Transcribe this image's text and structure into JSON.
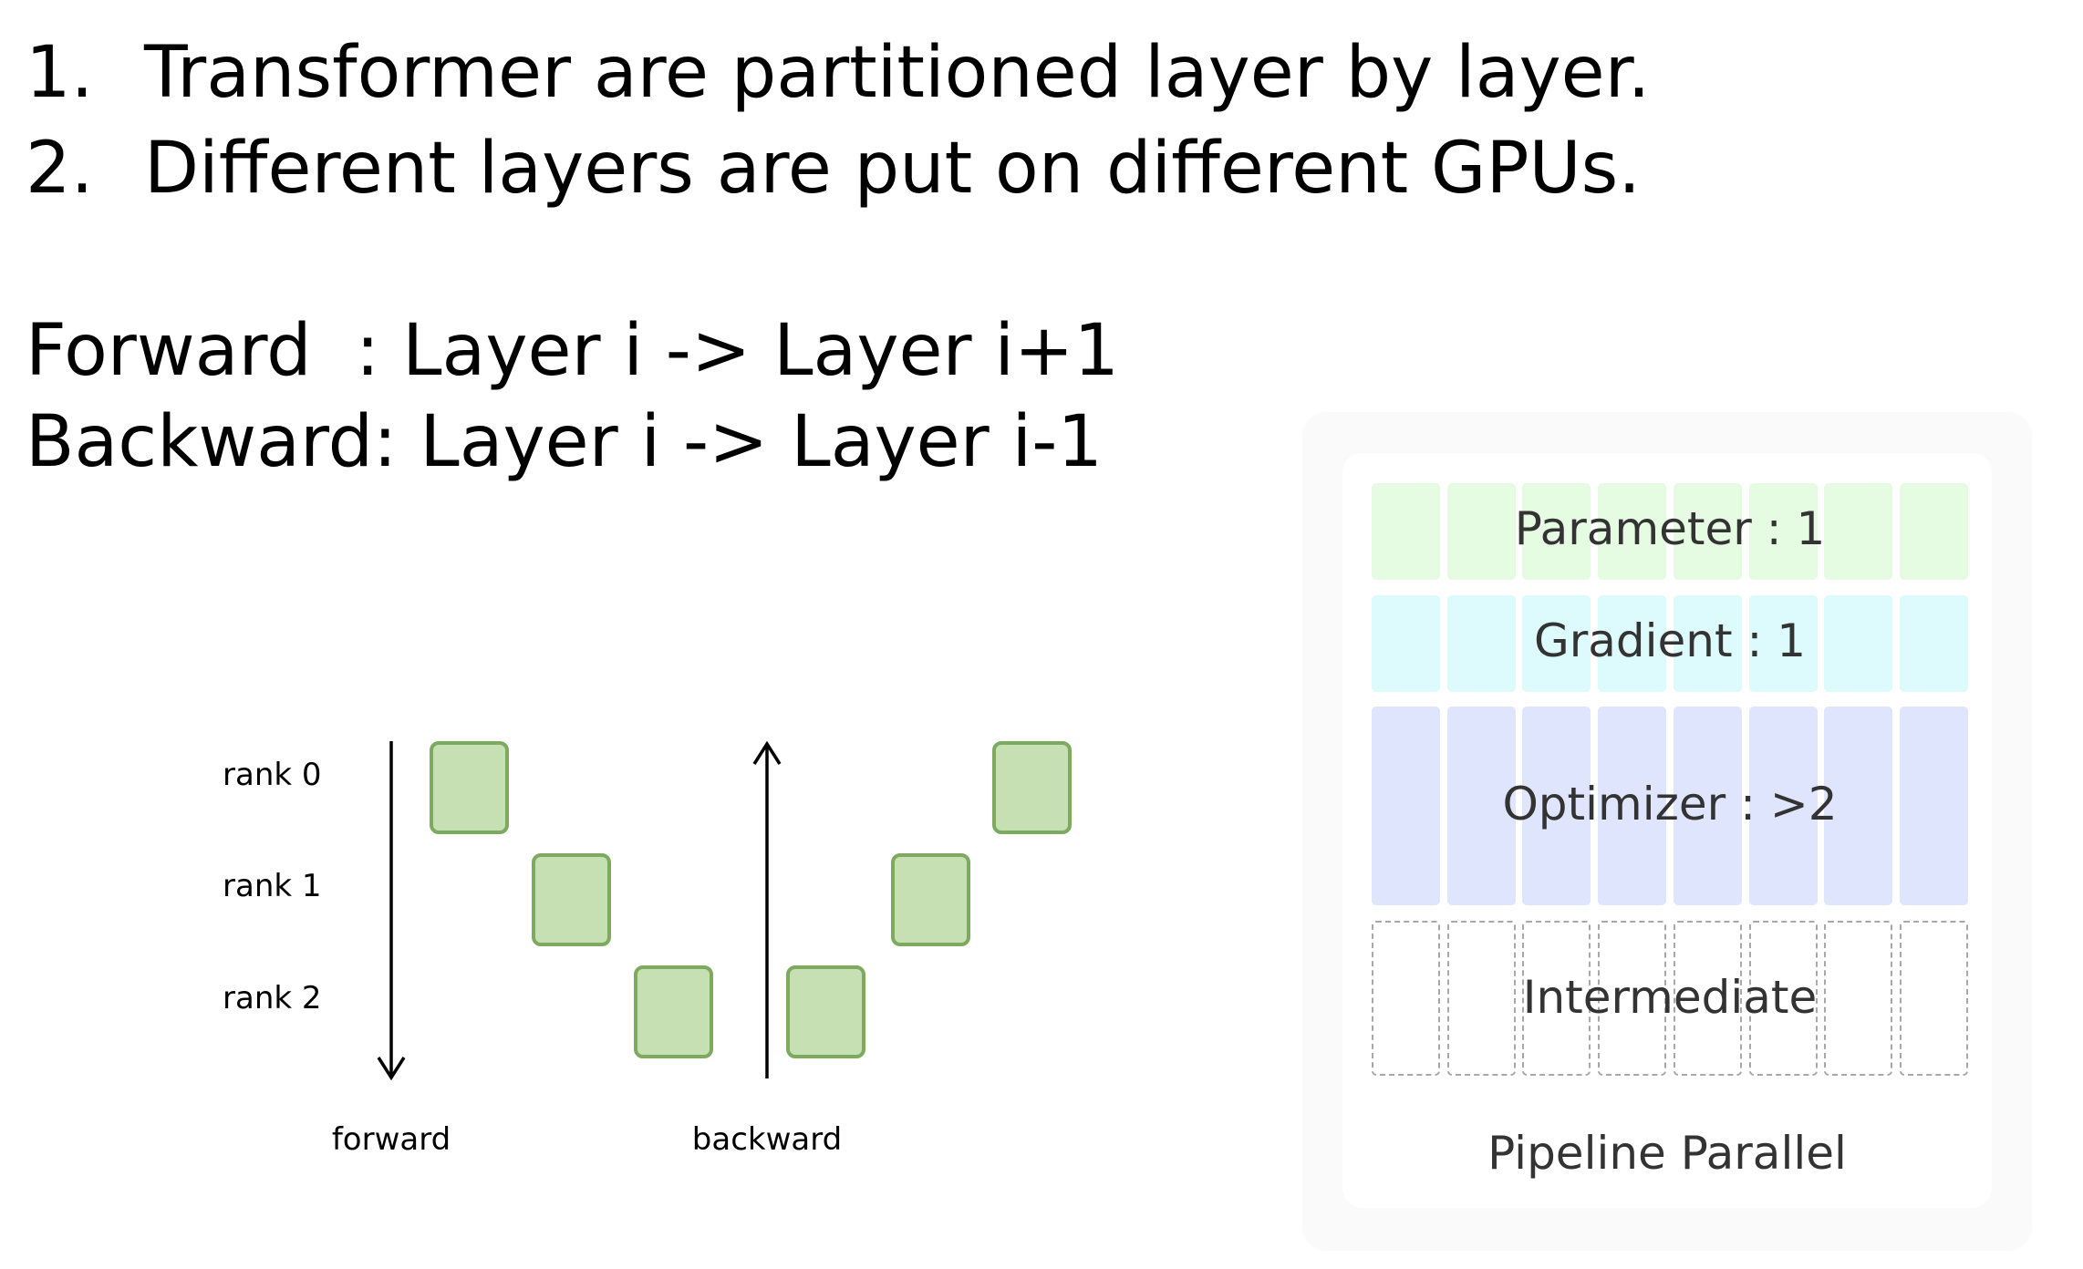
{
  "points": [
    {
      "num": "1.",
      "text": "Transformer are partitioned layer by layer."
    },
    {
      "num": "2.",
      "text": "Different layers are put on different GPUs."
    }
  ],
  "forward_rule": {
    "label": "Forward",
    "text": ": Layer i -> Layer i+1"
  },
  "backward_rule": {
    "label": "Backward",
    "text": ": Layer i -> Layer i-1"
  },
  "pipeline_diagram": {
    "ranks": [
      "rank 0",
      "rank 1",
      "rank 2"
    ],
    "forward_label": "forward",
    "backward_label": "backward",
    "box_color": "#c6e0b4",
    "box_border_color": "#7daa5f"
  },
  "memory_panel": {
    "columns": 8,
    "rows": [
      {
        "label": "Parameter : 1",
        "color": "#e5fbe2"
      },
      {
        "label": "Gradient : 1",
        "color": "#ddfafd"
      },
      {
        "label": "Optimizer : >2",
        "color": "#dfe5fd"
      },
      {
        "label": "Intermediate",
        "style": "dashed"
      }
    ],
    "caption": "Pipeline Parallel"
  }
}
